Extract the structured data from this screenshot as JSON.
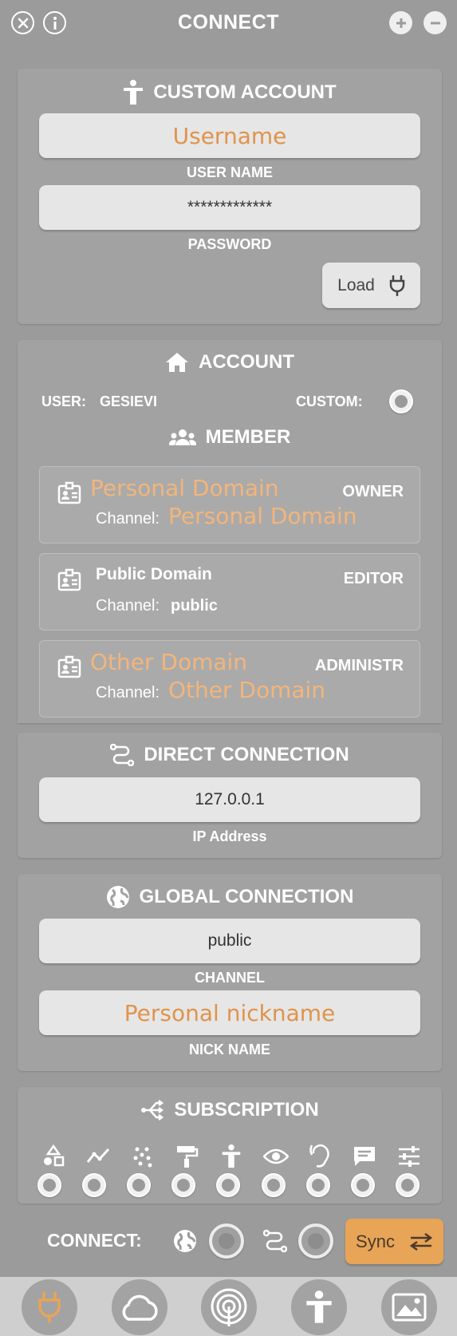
{
  "window": {
    "title": "CONNECT"
  },
  "custom_account": {
    "title": "CUSTOM ACCOUNT",
    "username_placeholder": "Username",
    "username_label": "USER NAME",
    "password_value": "*************",
    "password_label": "PASSWORD",
    "load_label": "Load"
  },
  "account": {
    "title": "ACCOUNT",
    "user_label": "USER:",
    "user_value": "GESIEVI",
    "custom_label": "CUSTOM:",
    "member_title": "MEMBER",
    "channel_label": "Channel:",
    "members": [
      {
        "name": "Personal Domain",
        "role": "OWNER",
        "channel": "Personal Domain"
      },
      {
        "name": "Public Domain",
        "role": "EDITOR",
        "channel": "public"
      },
      {
        "name": "Other Domain",
        "role": "ADMINISTR",
        "channel": "Other Domain"
      }
    ]
  },
  "direct_connection": {
    "title": "DIRECT CONNECTION",
    "ip_value": "127.0.0.1",
    "ip_label": "IP Address"
  },
  "global_connection": {
    "title": "GLOBAL CONNECTION",
    "channel_value": "public",
    "channel_label": "CHANNEL",
    "nickname_placeholder": "Personal nickname",
    "nickname_label": "NICK NAME"
  },
  "subscription": {
    "title": "SUBSCRIPTION",
    "icons": [
      "shapes-icon",
      "chart-line-icon",
      "dots-grid-icon",
      "paint-roller-icon",
      "person-icon",
      "eye-icon",
      "ear-icon",
      "chat-icon",
      "sliders-icon"
    ]
  },
  "footer": {
    "connect_label": "CONNECT:",
    "sync_label": "Sync"
  },
  "tabs": [
    "plug-icon",
    "cloud-icon",
    "broadcast-icon",
    "person-icon",
    "image-icon"
  ],
  "colors": {
    "accent": "#e8a457",
    "placeholder": "#e0934a",
    "background": "#9b9b9b",
    "panel": "#a2a2a2"
  }
}
